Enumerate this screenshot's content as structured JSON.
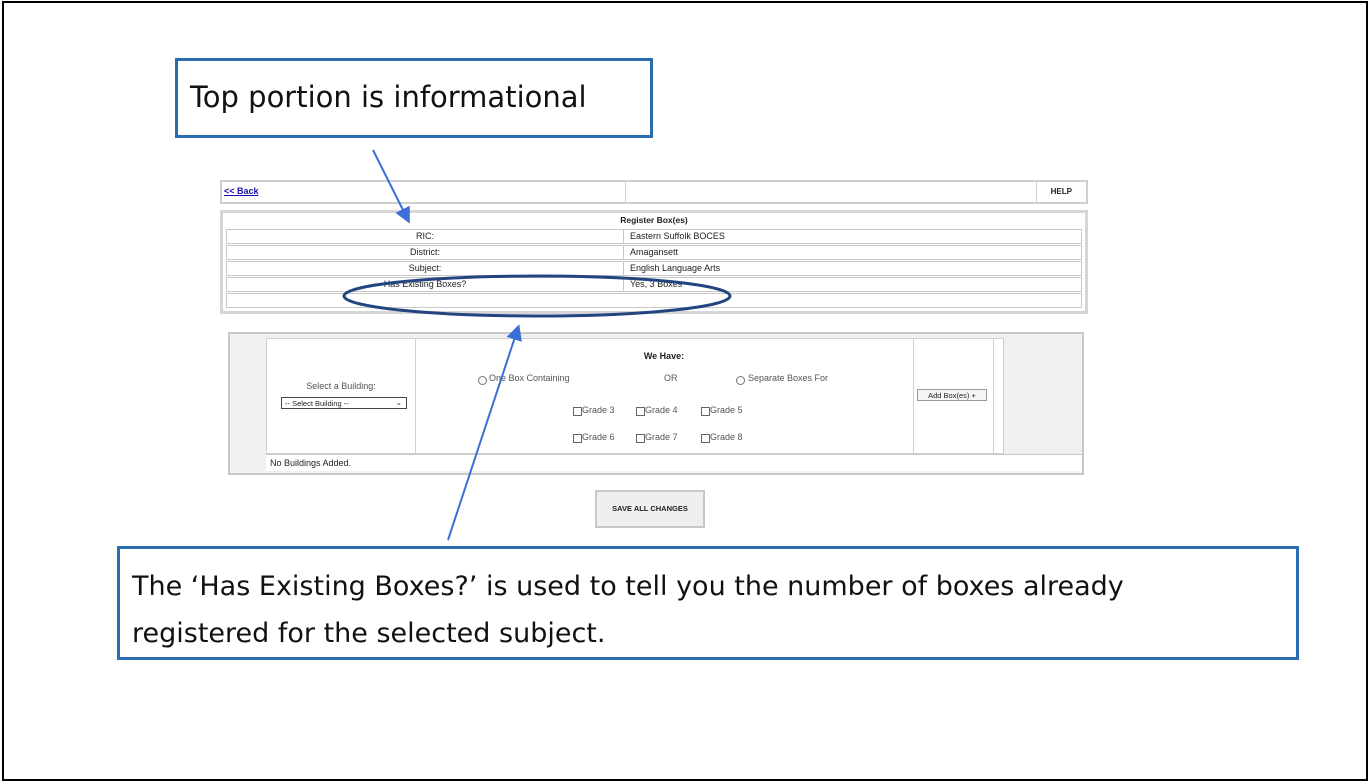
{
  "callouts": {
    "top": "Top portion is informational",
    "bottom_line1": "The ‘Has Existing Boxes?’ is used to tell you the number of boxes already",
    "bottom_line2": "registered for the selected subject."
  },
  "toolbar": {
    "back_label": "<< Back",
    "help_label": "HELP"
  },
  "register": {
    "title": "Register Box(es)",
    "rows": [
      {
        "label": "RIC:",
        "value": "Eastern Suffolk BOCES"
      },
      {
        "label": "District:",
        "value": "Amagansett"
      },
      {
        "label": "Subject:",
        "value": "English Language Arts"
      },
      {
        "label": "Has Existing Boxes?",
        "value": "Yes, 3 Boxes"
      }
    ]
  },
  "building_form": {
    "select_label": "Select a Building:",
    "select_value": "-- Select Building --",
    "we_have": "We Have:",
    "option_one": "One Box Containing",
    "or": "OR",
    "option_separate": "Separate Boxes For",
    "grades": [
      "Grade 3",
      "Grade 4",
      "Grade 5",
      "Grade 6",
      "Grade 7",
      "Grade 8"
    ],
    "add_button": "Add Box(es) +",
    "no_buildings": "No Buildings Added."
  },
  "save_button": "SAVE ALL CHANGES",
  "colors": {
    "callout_border": "#2b6cb0",
    "arrow": "#3b6fd6",
    "ellipse": "#23457f"
  }
}
